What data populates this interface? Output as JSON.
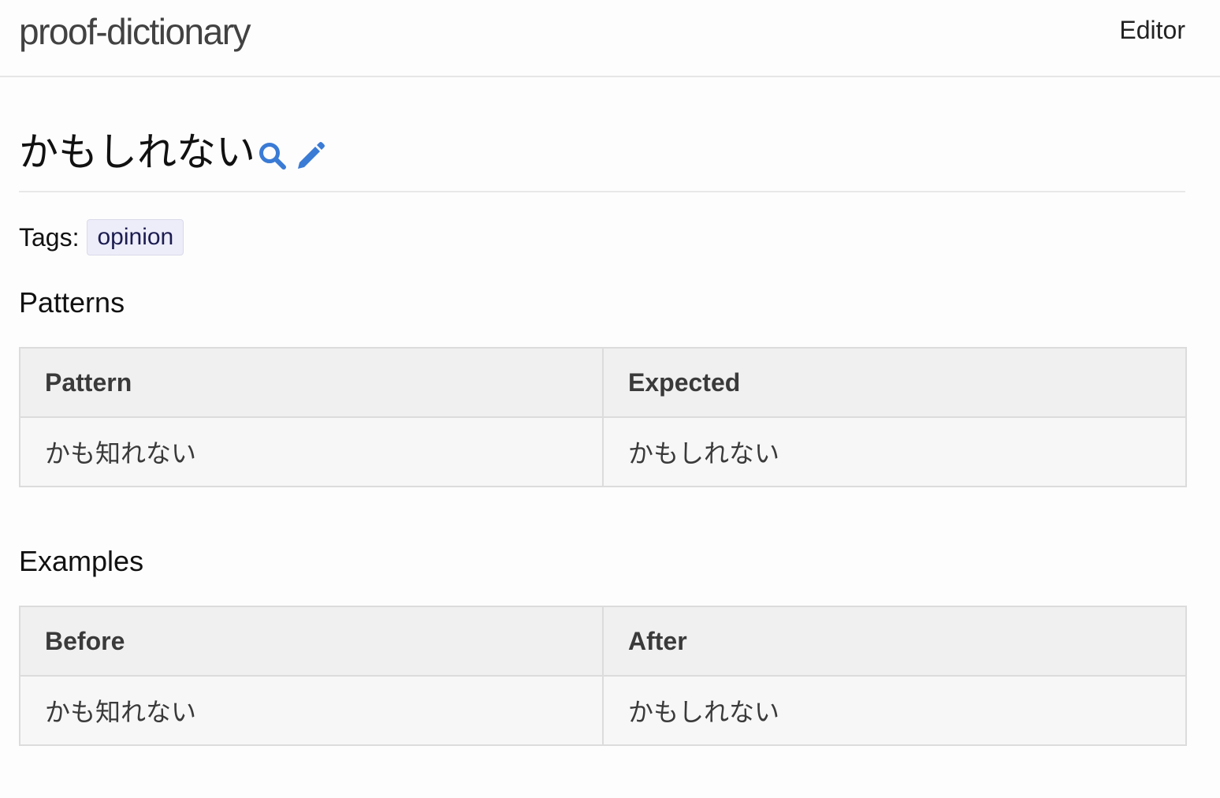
{
  "header": {
    "brand": "proof-dictionary",
    "nav_link": "Editor"
  },
  "entry": {
    "title": "かもしれない",
    "search_icon": "search-icon",
    "edit_icon": "pencil-icon",
    "icon_color": "#3a7bd5"
  },
  "tags": {
    "label": "Tags:",
    "items": [
      "opinion"
    ]
  },
  "patterns": {
    "heading": "Patterns",
    "columns": [
      "Pattern",
      "Expected"
    ],
    "rows": [
      [
        "かも知れない",
        "かもしれない"
      ]
    ]
  },
  "examples": {
    "heading": "Examples",
    "columns": [
      "Before",
      "After"
    ],
    "rows": [
      [
        "かも知れない",
        "かもしれない"
      ]
    ]
  }
}
